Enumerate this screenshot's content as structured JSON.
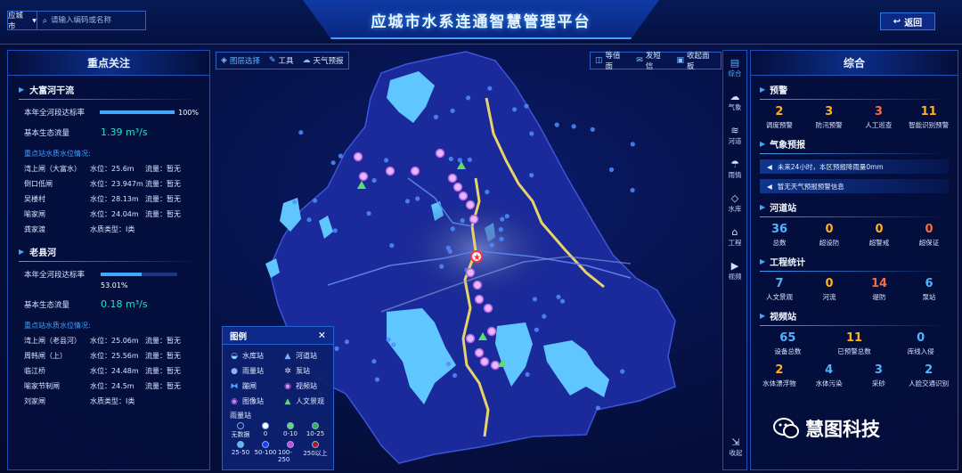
{
  "header": {
    "title": "应城市水系连通智慧管理平台",
    "city": "应城市",
    "search_placeholder": "请输入编码或名称",
    "back_label": "返回"
  },
  "left": {
    "title": "重点关注",
    "rivers": [
      {
        "name": "大富河干流",
        "rate_label": "本年全河段达标率",
        "rate_value": "100%",
        "rate_fraction": 1.0,
        "flow_label": "基本生态流量",
        "flow_value": "1.39 m³/s",
        "stations_title": "重点站水质水位情况:",
        "stations": [
          {
            "name": "湾上闸（大富水）",
            "level": "水位：25.6m",
            "flow": "流量：暂无"
          },
          {
            "name": "倒口低闸",
            "level": "水位：23.947m",
            "flow": "流量：暂无"
          },
          {
            "name": "吴楼村",
            "level": "水位：28.13m",
            "flow": "流量：暂无"
          },
          {
            "name": "喻家闸",
            "level": "水位：24.04m",
            "flow": "流量：暂无"
          },
          {
            "name": "龚家渡",
            "level": "水质类型：Ⅰ类",
            "flow": ""
          }
        ]
      },
      {
        "name": "老县河",
        "rate_label": "本年全河段达标率",
        "rate_value": "53.01%",
        "rate_fraction": 0.5301,
        "flow_label": "基本生态流量",
        "flow_value": "0.18 m³/s",
        "stations_title": "重点站水质水位情况:",
        "stations": [
          {
            "name": "湾上闸（老县河）",
            "level": "水位：25.06m",
            "flow": "流量：暂无"
          },
          {
            "name": "周韩闸（上）",
            "level": "水位：25.56m",
            "flow": "流量：暂无"
          },
          {
            "name": "临江桥",
            "level": "水位：24.48m",
            "flow": "流量：暂无"
          },
          {
            "name": "喻家节制闸",
            "level": "水位：24.5m",
            "flow": "流量：暂无"
          },
          {
            "name": "刘家闸",
            "level": "水质类型：Ⅰ类",
            "flow": ""
          }
        ]
      }
    ]
  },
  "map_toolbar": {
    "left": [
      "图层选择",
      "工具",
      "天气预报"
    ],
    "right": [
      "等值面",
      "发短信",
      "收起面板"
    ]
  },
  "legend": {
    "title": "图例",
    "items": [
      "水库站",
      "河道站",
      "雨量站",
      "泵站",
      "蹦闸",
      "视频站",
      "图像站",
      "人文景观"
    ],
    "rain_title": "雨量站",
    "rain_levels": [
      {
        "label": "无数据",
        "color": "#0b1f6e"
      },
      {
        "label": "0",
        "color": "#ffffff"
      },
      {
        "label": "0-10",
        "color": "#59e06a"
      },
      {
        "label": "10-25",
        "color": "#34b34a"
      },
      {
        "label": "25-50",
        "color": "#5ab8ff"
      },
      {
        "label": "50-100",
        "color": "#1a3cff"
      },
      {
        "label": "100-250",
        "color": "#e040e0"
      },
      {
        "label": "250以上",
        "color": "#b01818"
      }
    ]
  },
  "side_nav": [
    "综合",
    "气象",
    "河道",
    "雨情",
    "水库",
    "工程",
    "视频"
  ],
  "side_nav_collapse": "收起",
  "right": {
    "title": "综合",
    "warning": {
      "title": "预警",
      "stats": [
        {
          "value": "2",
          "label": "调度预警",
          "color": "#ffb020"
        },
        {
          "value": "3",
          "label": "防汛预警",
          "color": "#ffb020"
        },
        {
          "value": "3",
          "label": "人工巡查",
          "color": "#ff6a3a"
        },
        {
          "value": "11",
          "label": "智能识别预警",
          "color": "#ffb020"
        }
      ]
    },
    "weather": {
      "title": "气象预报",
      "lines": [
        "未来24小时，本区预报降雨量0mm",
        "暂无天气预报预警信息"
      ]
    },
    "river": {
      "title": "河道站",
      "stats": [
        {
          "value": "36",
          "label": "总数",
          "color": "#4fb4ff"
        },
        {
          "value": "0",
          "label": "超设防",
          "color": "#ffb020"
        },
        {
          "value": "0",
          "label": "超警戒",
          "color": "#ffb020"
        },
        {
          "value": "0",
          "label": "超保证",
          "color": "#ff6a3a"
        }
      ]
    },
    "engineering": {
      "title": "工程统计",
      "stats": [
        {
          "value": "7",
          "label": "人文景观",
          "color": "#4fb4ff"
        },
        {
          "value": "0",
          "label": "河流",
          "color": "#ffb020"
        },
        {
          "value": "14",
          "label": "堤防",
          "color": "#ff6a3a"
        },
        {
          "value": "6",
          "label": "泵站",
          "color": "#4fb4ff"
        }
      ]
    },
    "video": {
      "title": "视频站",
      "stats_top": [
        {
          "value": "65",
          "label": "设备总数",
          "color": "#4fb4ff"
        },
        {
          "value": "11",
          "label": "已预警总数",
          "color": "#ffb020"
        },
        {
          "value": "0",
          "label": "库线入侵",
          "color": "#4fb4ff"
        }
      ],
      "stats_bottom": [
        {
          "value": "2",
          "label": "水体漂浮物",
          "color": "#ffb020"
        },
        {
          "value": "4",
          "label": "水体污染",
          "color": "#4fb4ff"
        },
        {
          "value": "3",
          "label": "采砂",
          "color": "#4fb4ff"
        },
        {
          "value": "2",
          "label": "人脸交通识别",
          "color": "#4fb4ff"
        }
      ]
    }
  },
  "watermark": "慧图科技"
}
